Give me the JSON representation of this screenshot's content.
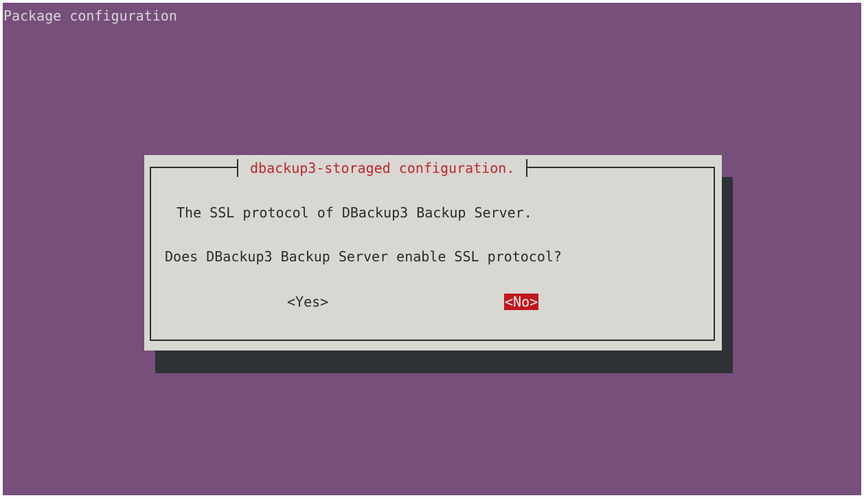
{
  "terminal": {
    "title": "Package configuration"
  },
  "dialog": {
    "title": "dbackup3-storaged configuration.",
    "message_line_1": "The SSL protocol of DBackup3 Backup Server.",
    "message_line_2": "Does DBackup3 Backup Server enable SSL protocol?",
    "buttons": {
      "yes": "<Yes>",
      "no": "<No>"
    },
    "selected_button": "no"
  },
  "colors": {
    "background": "#764f7b",
    "dialog": "#d8d7d2",
    "shadow": "#2f3236",
    "title_text": "#c0262d",
    "selected_bg": "#c2171d"
  }
}
